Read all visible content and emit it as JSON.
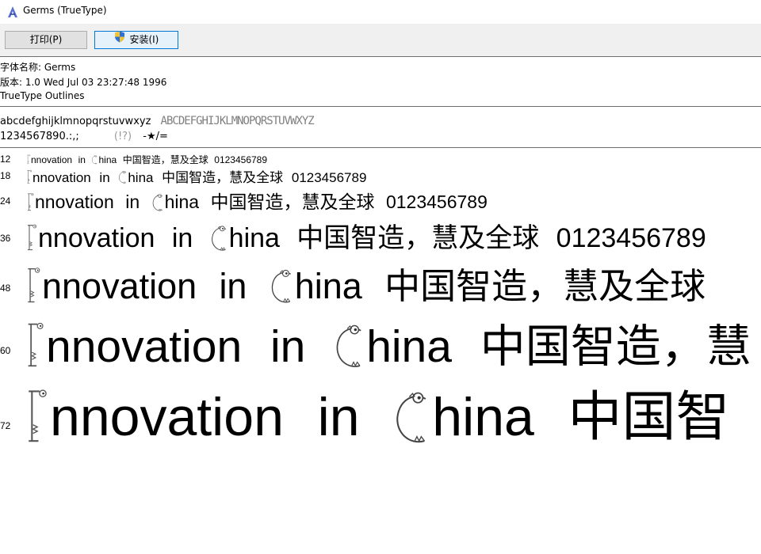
{
  "window": {
    "title": "Germs (TrueType)"
  },
  "toolbar": {
    "print_label": "打印(P)",
    "install_label": "安装(I)"
  },
  "font_info": {
    "name_line": "字体名称: Germs",
    "version_line": "版本: 1.0 Wed Jul 03 23:27:48 1996",
    "type_line": "TrueType Outlines"
  },
  "charset": {
    "lowercase": "abcdefghijklmnopqrstuvwxyz",
    "uppercase_glyphs": "ABCDEFGHIJKLMNOPQRSTUVWXYZ",
    "digits": "1234567890.:,;",
    "punct": "(!?)",
    "symbols": "-★/="
  },
  "samples": [
    {
      "size": "12",
      "word1": "nnovation",
      "word2": "in",
      "word3": "hina",
      "cjk": "中国智造，慧及全球",
      "digits": "0123456789"
    },
    {
      "size": "18",
      "word1": "nnovation",
      "word2": "in",
      "word3": "hina",
      "cjk": "中国智造，慧及全球",
      "digits": "0123456789"
    },
    {
      "size": "24",
      "word1": "nnovation",
      "word2": "in",
      "word3": "hina",
      "cjk": "中国智造，慧及全球",
      "digits": "0123456789"
    },
    {
      "size": "36",
      "word1": "nnovation",
      "word2": "in",
      "word3": "hina",
      "cjk": "中国智造，慧及全球",
      "digits": "0123456789"
    },
    {
      "size": "48",
      "word1": "nnovation",
      "word2": "in",
      "word3": "hina",
      "cjk": "中国智造，慧及全球",
      "digits": ""
    },
    {
      "size": "60",
      "word1": "nnovation",
      "word2": "in",
      "word3": "hina",
      "cjk": "中国智造，慧",
      "digits": ""
    },
    {
      "size": "72",
      "word1": "nnovation",
      "word2": "in",
      "word3": "hina",
      "cjk": "中国智",
      "digits": ""
    }
  ]
}
